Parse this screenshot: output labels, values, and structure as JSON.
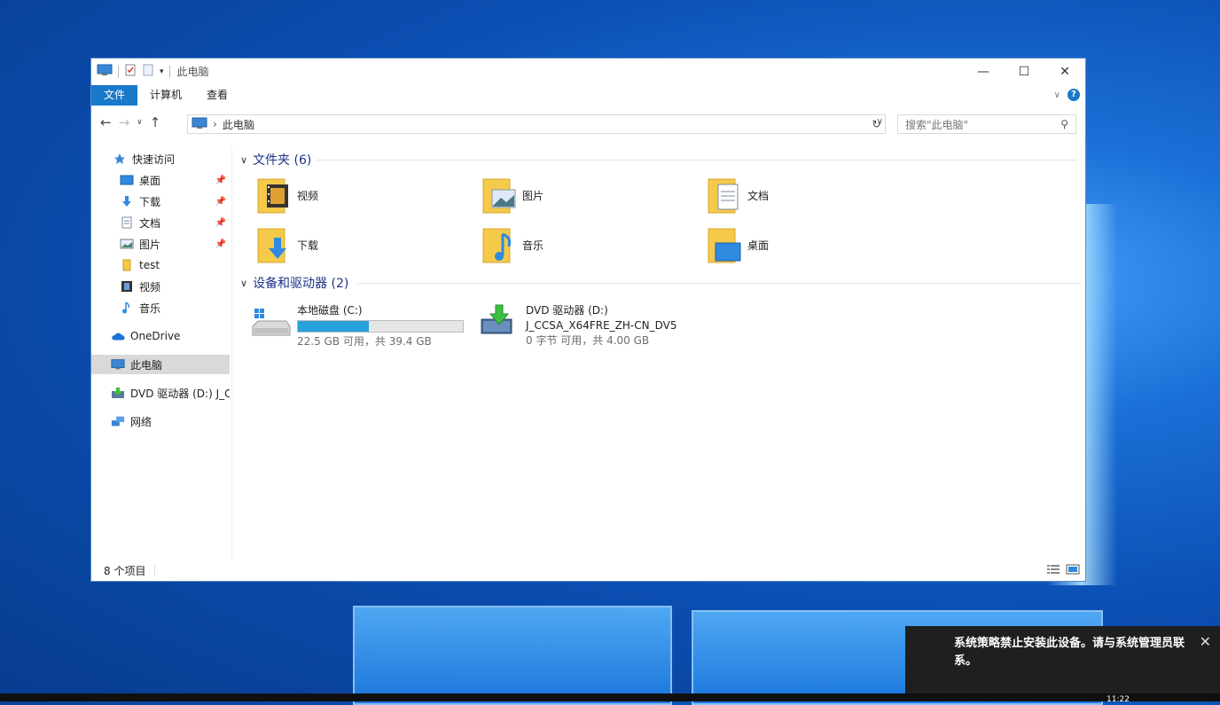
{
  "window": {
    "title": "此电脑",
    "controls": {
      "minimize": "—",
      "maximize": "☐",
      "close": "✕"
    }
  },
  "ribbon": {
    "tabs": [
      {
        "label": "文件",
        "active": true
      },
      {
        "label": "计算机",
        "active": false
      },
      {
        "label": "查看",
        "active": false
      }
    ]
  },
  "address": {
    "crumb": "此电脑",
    "search_placeholder": "搜索\"此电脑\""
  },
  "navpane": {
    "quick_access": "快速访问",
    "items": [
      {
        "label": "桌面",
        "pinned": true
      },
      {
        "label": "下载",
        "pinned": true
      },
      {
        "label": "文档",
        "pinned": true
      },
      {
        "label": "图片",
        "pinned": true
      },
      {
        "label": "test",
        "pinned": false
      },
      {
        "label": "视频",
        "pinned": false
      },
      {
        "label": "音乐",
        "pinned": false
      }
    ],
    "onedrive": "OneDrive",
    "this_pc": "此电脑",
    "dvd": "DVD 驱动器 (D:) J_C",
    "network": "网络"
  },
  "folders_group": {
    "header": "文件夹 (6)",
    "folders": [
      "视频",
      "图片",
      "文档",
      "下载",
      "音乐",
      "桌面"
    ]
  },
  "drives_group": {
    "header": "设备和驱动器 (2)",
    "drives": [
      {
        "name": "本地磁盘 (C:)",
        "usage": "22.5 GB 可用，共 39.4 GB",
        "used_fraction": 0.43
      },
      {
        "name": "DVD 驱动器 (D:)",
        "label": "J_CCSA_X64FRE_ZH-CN_DV5",
        "usage": "0 字节 可用，共 4.00 GB"
      }
    ]
  },
  "status": {
    "count": "8 个项目"
  },
  "toast": {
    "message": "系统策略禁止安装此设备。请与系统管理员联系。"
  },
  "taskbar": {
    "clock": "11:22"
  },
  "colors": {
    "accent": "#1979ca",
    "progress": "#26a0da",
    "folder": "#f5c94a"
  }
}
